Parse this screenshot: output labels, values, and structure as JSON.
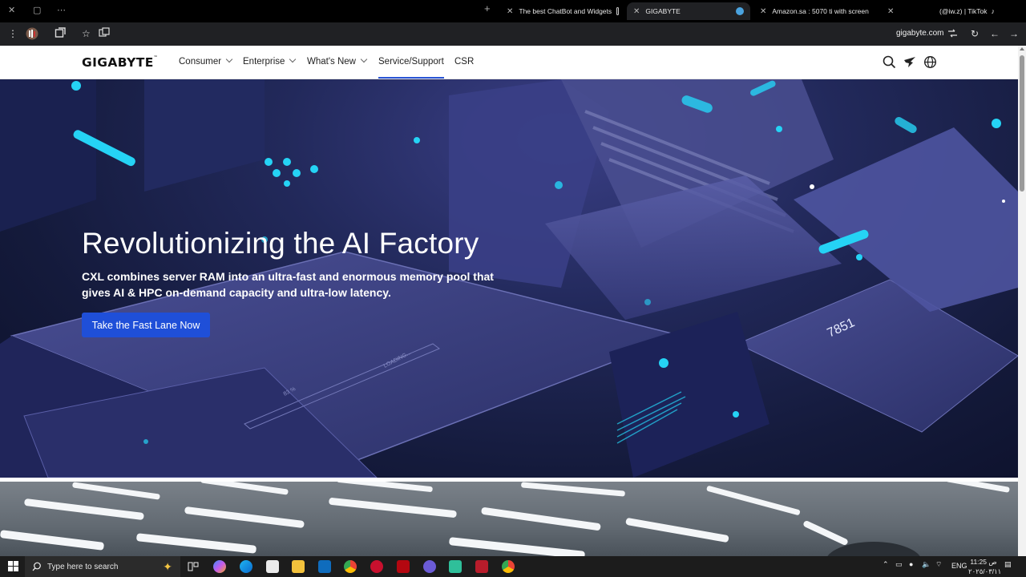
{
  "browser": {
    "tabs": [
      {
        "title": "The best ChatBot and Widgets",
        "active": false
      },
      {
        "title": "GIGABYTE",
        "active": true
      },
      {
        "title": "Amazon.sa : 5070 ti with screen",
        "active": false
      },
      {
        "title": "(@iw.z) | TikTok",
        "active": false
      }
    ],
    "url": "gigabyte.com"
  },
  "site": {
    "logo": "GIGABYTE",
    "nav": [
      {
        "label": "Consumer",
        "dropdown": true
      },
      {
        "label": "Enterprise",
        "dropdown": true
      },
      {
        "label": "What's New",
        "dropdown": true
      },
      {
        "label": "Service/Support",
        "dropdown": false,
        "active": true
      },
      {
        "label": "CSR",
        "dropdown": false
      }
    ],
    "icons": [
      "search-icon",
      "aorus-icon",
      "globe-icon"
    ]
  },
  "hero": {
    "title": "Revolutionizing the AI Factory",
    "subtitle": "CXL combines server RAM into an ultra-fast and enormous memory pool that gives AI & HPC on-demand capacity and ultra-low latency.",
    "cta": "Take the Fast Lane Now",
    "art_text": {
      "loading": "LOADING...",
      "percent": "83 %",
      "readout": "7851"
    }
  },
  "taskbar": {
    "search_placeholder": "Type here to search",
    "language": "ENG",
    "time": "11:25 ص",
    "date": "٢٠٢٥/٠٣/١١"
  },
  "colors": {
    "cta": "#1f4fd8",
    "nav_active_underline": "#2a55d6",
    "hero_bg": "#1b2150",
    "accent_cyan": "#25d3f5"
  }
}
